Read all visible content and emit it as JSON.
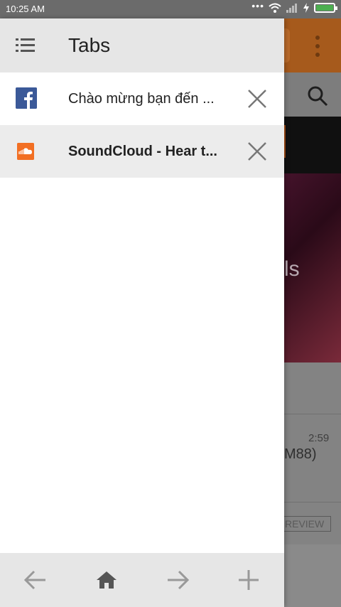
{
  "status_bar": {
    "time": "10:25 AM",
    "icons": [
      "wifi-icon",
      "signal-icon",
      "charging-icon",
      "battery-icon"
    ],
    "battery_color": "#4caf50"
  },
  "drawer": {
    "title": "Tabs",
    "menu_icon": "list-icon"
  },
  "tabs": [
    {
      "title": "Chào mừng bạn đến ...",
      "favicon": "facebook-icon",
      "active": false
    },
    {
      "title": "SoundCloud - Hear t...",
      "favicon": "soundcloud-icon",
      "active": true
    }
  ],
  "bottom_bar": {
    "icons": [
      "back-arrow-icon",
      "home-icon",
      "forward-arrow-icon",
      "new-tab-plus-icon"
    ]
  },
  "background_page": {
    "partial_text": "ls",
    "duration": "2:59",
    "partial_label": "M88)",
    "partial_button": "REVIEW"
  },
  "colors": {
    "drawer_header": "#e6e6e6",
    "active_tab": "#ececec",
    "facebook_blue": "#3b5998",
    "soundcloud_orange": "#f26f23"
  }
}
